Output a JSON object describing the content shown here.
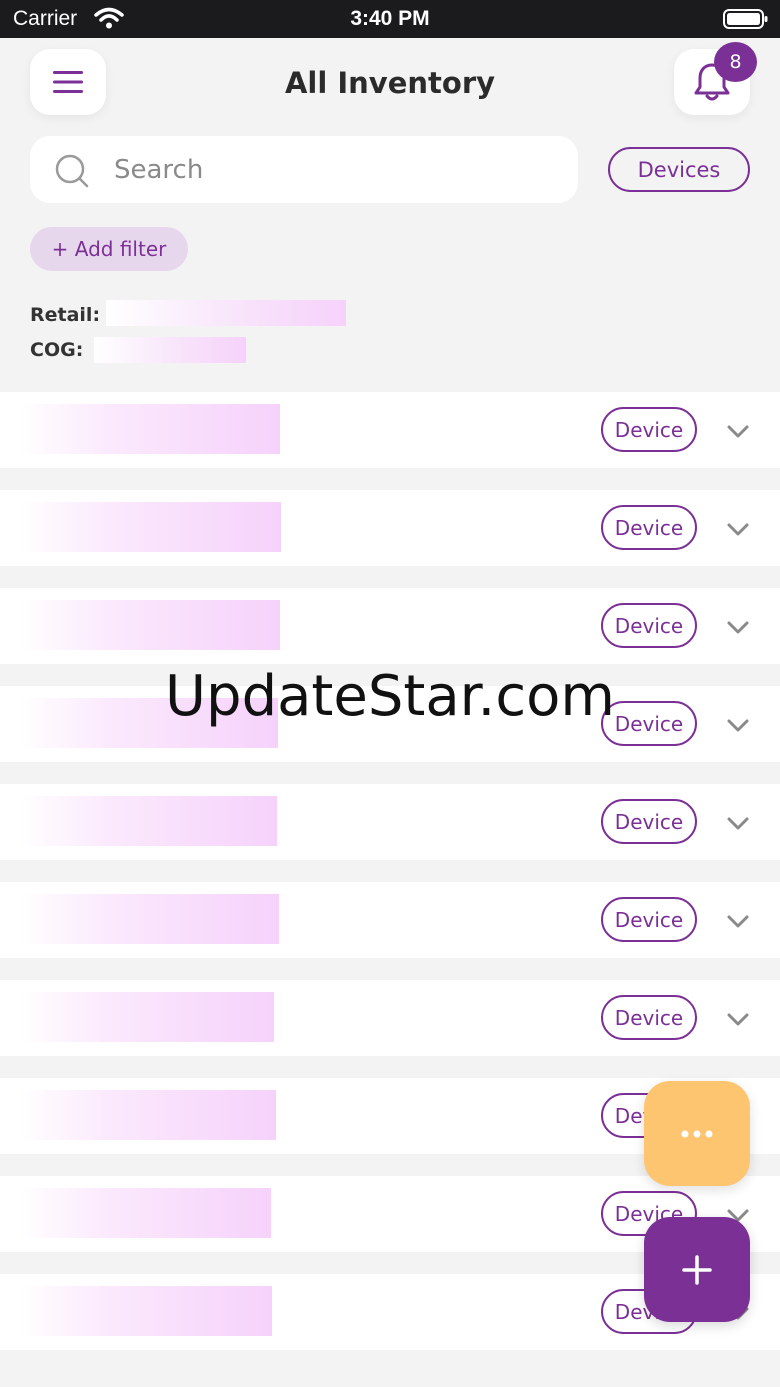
{
  "status_bar": {
    "carrier": "Carrier",
    "time": "3:40 PM"
  },
  "header": {
    "title": "All Inventory",
    "notification_count": "8"
  },
  "search": {
    "placeholder": "Search",
    "value": "",
    "type_filter": "Devices"
  },
  "filters": {
    "add_filter_label": "+ Add filter"
  },
  "summary": {
    "retail_label": "Retail:",
    "cog_label": "COG:"
  },
  "inventory": {
    "rows": [
      {
        "tag": "Device"
      },
      {
        "tag": "Device"
      },
      {
        "tag": "Device"
      },
      {
        "tag": "Device"
      },
      {
        "tag": "Device"
      },
      {
        "tag": "Device"
      },
      {
        "tag": "Device"
      },
      {
        "tag": "Device"
      },
      {
        "tag": "Device"
      },
      {
        "tag": "Device"
      }
    ]
  },
  "watermark": "UpdateStar.com",
  "icons": {
    "menu": "hamburger-menu-icon",
    "notifications": "bell-icon",
    "search": "search-icon",
    "row_expand": "chevron-down-icon",
    "more": "more-dots-icon",
    "add": "plus-icon"
  },
  "colors": {
    "accent": "#7b3096",
    "fab_secondary": "#fec571",
    "background": "#f3f3f3",
    "status_bar": "#1b1b1d"
  }
}
